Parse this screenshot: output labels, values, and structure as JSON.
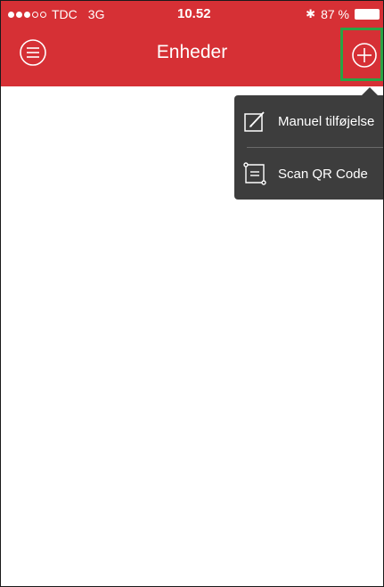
{
  "status_bar": {
    "carrier": "TDC",
    "network": "3G",
    "time": "10.52",
    "battery": "87 %",
    "signal_bars_filled": 3,
    "signal_bars_total": 5
  },
  "navbar": {
    "title": "Enheder",
    "menu_icon": "menu-icon",
    "add_icon": "plus-circle-icon"
  },
  "add_menu": {
    "items": [
      {
        "label": "Manuel tilføjelse",
        "icon": "edit-icon"
      },
      {
        "label": "Scan QR Code",
        "icon": "qr-scan-icon"
      }
    ]
  },
  "colors": {
    "header": "#d63035",
    "popover": "#3d3d3d",
    "highlight": "#2aa344"
  }
}
